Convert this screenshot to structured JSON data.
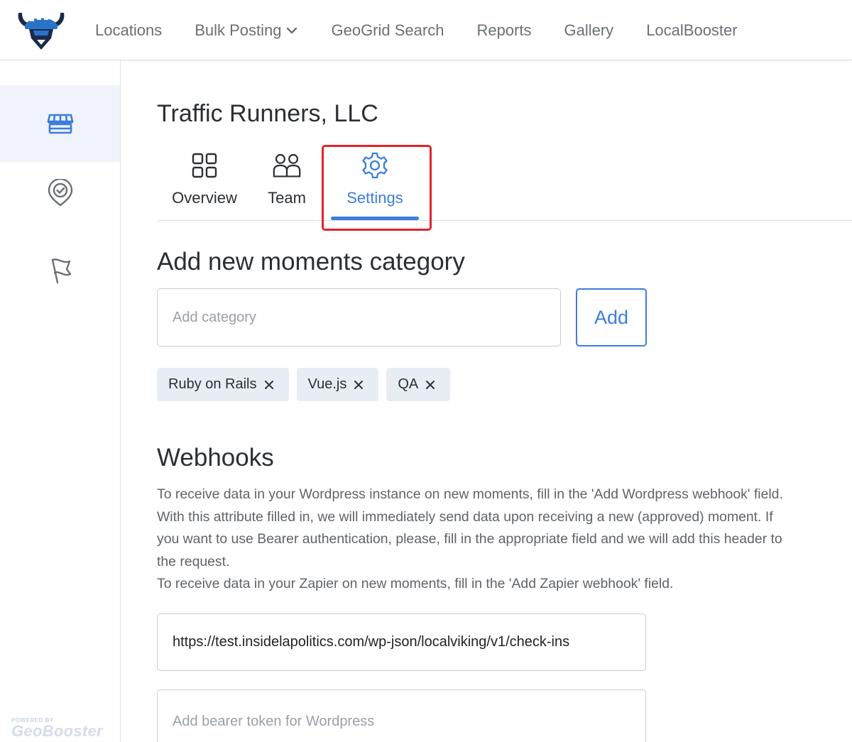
{
  "nav": {
    "items": [
      {
        "label": "Locations"
      },
      {
        "label": "Bulk Posting"
      },
      {
        "label": "GeoGrid Search"
      },
      {
        "label": "Reports"
      },
      {
        "label": "Gallery"
      },
      {
        "label": "LocalBooster"
      }
    ]
  },
  "sidebar": {
    "items": [
      {
        "icon": "storefront-icon",
        "active": true
      },
      {
        "icon": "location-check-icon",
        "active": false
      },
      {
        "icon": "flag-icon",
        "active": false
      }
    ],
    "powered_small": "POWERED BY",
    "powered_brand": "GeoBooster"
  },
  "page": {
    "company": "Traffic Runners, LLC",
    "tabs": [
      {
        "label": "Overview",
        "icon": "grid-icon"
      },
      {
        "label": "Team",
        "icon": "team-icon"
      },
      {
        "label": "Settings",
        "icon": "gear-icon",
        "active": true
      }
    ]
  },
  "moments": {
    "title": "Add new moments category",
    "input_placeholder": "Add category",
    "input_value": "",
    "add_label": "Add",
    "tags": [
      "Ruby on Rails",
      "Vue.js",
      "QA"
    ]
  },
  "webhooks": {
    "title": "Webhooks",
    "description_lines": [
      "To receive data in your Wordpress instance on new moments, fill in the 'Add Wordpress webhook' field.",
      "With this attribute filled in, we will immediately send data upon receiving a new (approved) moment. If",
      "you want to use Bearer authentication, please, fill in the appropriate field and we will add this header to",
      "the request.",
      "To receive data in your Zapier on new moments, fill in the 'Add Zapier webhook' field."
    ],
    "wordpress_url_value": "https://test.insidelapolitics.com/wp-json/localviking/v1/check-ins",
    "bearer_placeholder": "Add bearer token for Wordpress"
  },
  "colors": {
    "accent": "#3b7ddd",
    "highlight": "#e0242b",
    "logo_blue": "#2a73c9",
    "logo_navy": "#1c2a4a",
    "tag_bg": "#e8edf4"
  }
}
